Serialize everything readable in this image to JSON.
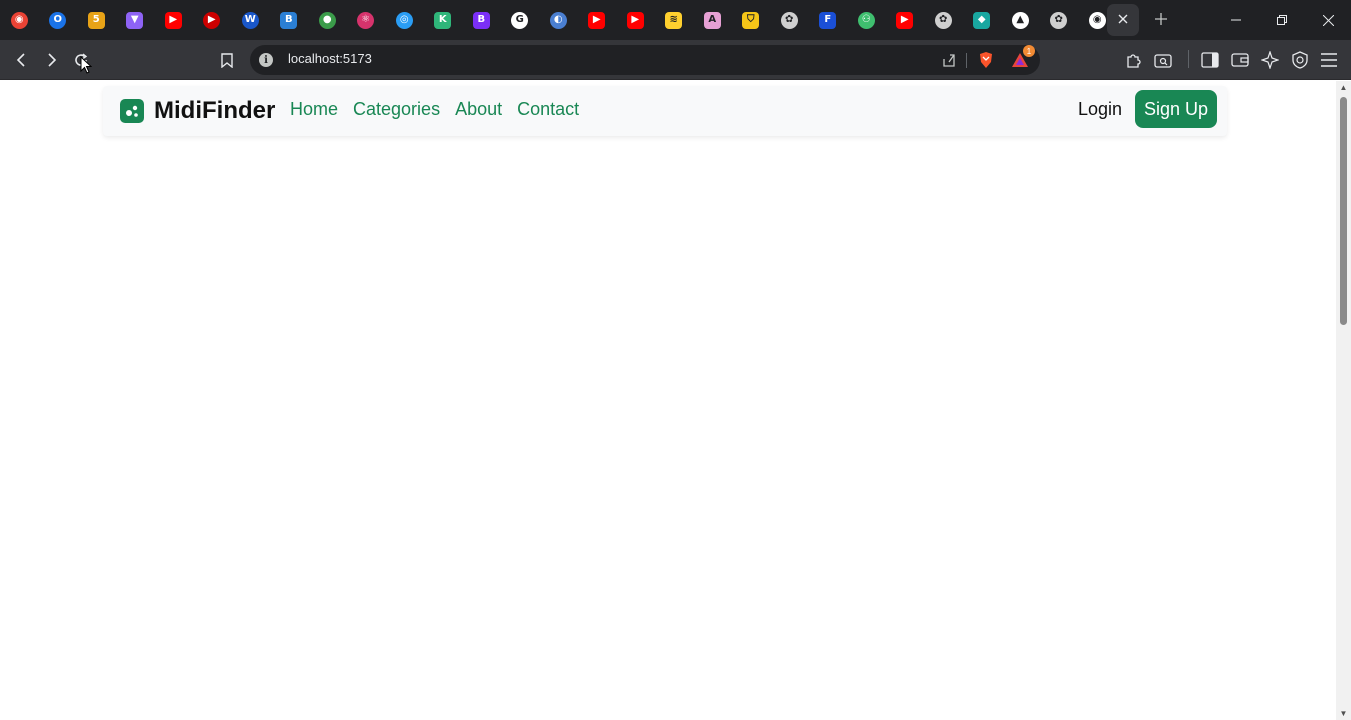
{
  "browser": {
    "pinned_tabs": [
      {
        "icon": "record-icon",
        "color": "#ea4335",
        "glyph": "◉",
        "shape": "circle"
      },
      {
        "icon": "opera-icon",
        "color": "#1a73e8",
        "glyph": "O",
        "shape": "circle"
      },
      {
        "icon": "html5-icon",
        "color": "#e8a317",
        "glyph": "5",
        "shape": "square"
      },
      {
        "icon": "vite-icon",
        "color": "#8e63f5",
        "glyph": "▼",
        "shape": "square"
      },
      {
        "icon": "youtube-icon",
        "color": "#ff0000",
        "glyph": "▶",
        "shape": "square"
      },
      {
        "icon": "youtube-music-icon",
        "color": "#cc0000",
        "glyph": "▶",
        "shape": "circle"
      },
      {
        "icon": "wordpress-icon",
        "color": "#1a57c9",
        "glyph": "W",
        "shape": "circle"
      },
      {
        "icon": "bootstrap-icon",
        "color": "#2b7fd4",
        "glyph": "B",
        "shape": "square"
      },
      {
        "icon": "figma-icon",
        "color": "#3b9c4a",
        "glyph": "●",
        "shape": "circle"
      },
      {
        "icon": "react-icon",
        "color": "#d6336c",
        "glyph": "⚛",
        "shape": "circle"
      },
      {
        "icon": "compass-icon",
        "color": "#2a9df4",
        "glyph": "◎",
        "shape": "circle"
      },
      {
        "icon": "k-icon",
        "color": "#2fb67a",
        "glyph": "K",
        "shape": "square"
      },
      {
        "icon": "bootstrap-b-icon",
        "color": "#7b2ff7",
        "glyph": "B",
        "shape": "square"
      },
      {
        "icon": "google-icon",
        "color": "#ffffff",
        "glyph": "G",
        "shape": "circle"
      },
      {
        "icon": "chromium-icon",
        "color": "#4a7fd1",
        "glyph": "◐",
        "shape": "circle"
      },
      {
        "icon": "youtube-icon",
        "color": "#ff0000",
        "glyph": "▶",
        "shape": "square"
      },
      {
        "icon": "youtube-icon",
        "color": "#ff0000",
        "glyph": "▶",
        "shape": "square"
      },
      {
        "icon": "miro-icon",
        "color": "#ffd02f",
        "glyph": "≋",
        "shape": "square"
      },
      {
        "icon": "affinity-icon",
        "color": "#e6a0d4",
        "glyph": "A",
        "shape": "square"
      },
      {
        "icon": "shield-icon",
        "color": "#f5c518",
        "glyph": "⛉",
        "shape": "square"
      },
      {
        "icon": "openai-icon",
        "color": "#cfcfcf",
        "glyph": "✿",
        "shape": "circle"
      },
      {
        "icon": "flag-icon",
        "color": "#1a4fd6",
        "glyph": "F",
        "shape": "square"
      },
      {
        "icon": "people-icon",
        "color": "#3fbf6f",
        "glyph": "⚇",
        "shape": "circle"
      },
      {
        "icon": "youtube-icon",
        "color": "#ff0000",
        "glyph": "▶",
        "shape": "square"
      },
      {
        "icon": "openai-icon",
        "color": "#cfcfcf",
        "glyph": "✿",
        "shape": "circle"
      },
      {
        "icon": "diamond-icon",
        "color": "#19a7a0",
        "glyph": "◆",
        "shape": "square"
      },
      {
        "icon": "triangle-icon",
        "color": "#ffffff",
        "glyph": "▲",
        "shape": "circle"
      },
      {
        "icon": "openai-icon",
        "color": "#cfcfcf",
        "glyph": "✿",
        "shape": "circle"
      },
      {
        "icon": "github-icon",
        "color": "#ffffff",
        "glyph": "◉",
        "shape": "circle"
      }
    ],
    "address": "localhost:5173",
    "notification_count": "1"
  },
  "navbar": {
    "brand": "MidiFinder",
    "links": [
      "Home",
      "Categories",
      "About",
      "Contact"
    ],
    "login": "Login",
    "signup": "Sign Up"
  },
  "colors": {
    "accent": "#198754",
    "chrome_dark": "#202124",
    "chrome_toolbar": "#35363a"
  }
}
